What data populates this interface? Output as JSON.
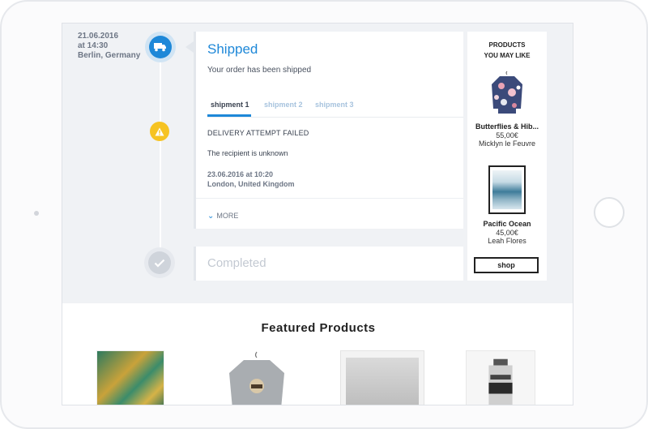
{
  "order": {
    "date": "21.06.2016",
    "time": "at 14:30",
    "location": "Berlin, Germany"
  },
  "status_card": {
    "title": "Shipped",
    "subtitle": "Your order has been shipped",
    "tabs": [
      {
        "label": "shipment 1",
        "active": true
      },
      {
        "label": "shipment 2",
        "active": false
      },
      {
        "label": "shipment 3",
        "active": false
      }
    ],
    "event": {
      "title": "DELIVERY ATTEMPT FAILED",
      "description": "The recipient is unknown",
      "datetime": "23.06.2016 at 10:20",
      "location": "London, United Kingdom"
    },
    "more_label": "MORE"
  },
  "completed_card": {
    "title": "Completed"
  },
  "timeline_icons": [
    "truck-icon",
    "warning-icon",
    "check-icon"
  ],
  "sidebar": {
    "title_line1": "PRODUCTS",
    "title_line2": "YOU MAY LIKE",
    "products": [
      {
        "name": "Butterflies & Hib...",
        "price": "55,00€",
        "author": "Micklyn le Feuvre"
      },
      {
        "name": "Pacific Ocean",
        "price": "45,00€",
        "author": "Leah Flores"
      }
    ],
    "shop_label": "shop"
  },
  "featured": {
    "title": "Featured Products"
  },
  "colors": {
    "accent": "#1e88d8",
    "warning": "#f6c322",
    "background": "#f0f2f5"
  }
}
